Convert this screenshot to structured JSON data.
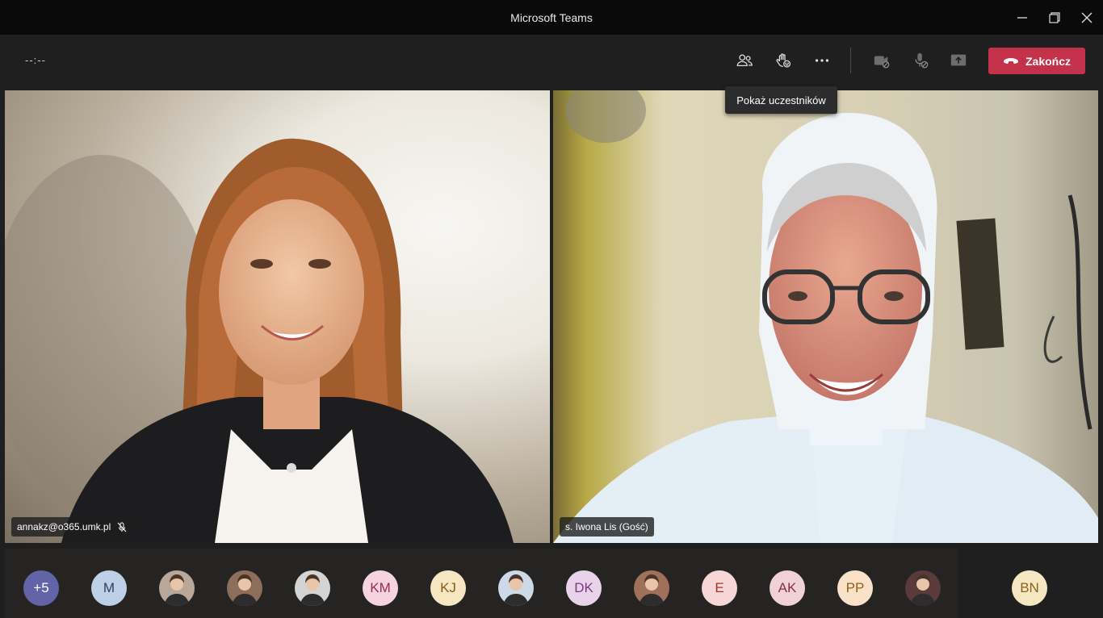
{
  "window": {
    "title": "Microsoft Teams"
  },
  "toolbar": {
    "timer": "--:--",
    "icons": [
      "people-icon",
      "raise-hand-icon",
      "more-options-icon",
      "camera-off-icon",
      "mic-off-icon",
      "share-screen-icon"
    ],
    "end_label": "Zakończ",
    "tooltip": "Pokaż uczestników"
  },
  "videos": [
    {
      "name": "annakz@o365.umk.pl",
      "muted": true
    },
    {
      "name": "s. Iwona Lis (Gość)",
      "muted": false
    }
  ],
  "participants": [
    {
      "initials": "+5",
      "bg": "#6264a7",
      "fg": "#ffffff",
      "photo": false
    },
    {
      "initials": "M",
      "bg": "#bdd0e8",
      "fg": "#2c3e66",
      "photo": false
    },
    {
      "initials": "",
      "bg": "#b9a89a",
      "fg": "#ffffff",
      "photo": true
    },
    {
      "initials": "",
      "bg": "#8d6e5a",
      "fg": "#ffffff",
      "photo": true
    },
    {
      "initials": "",
      "bg": "#d4d4d4",
      "fg": "#ffffff",
      "photo": true
    },
    {
      "initials": "KM",
      "bg": "#f6d4df",
      "fg": "#9b2a55",
      "photo": false
    },
    {
      "initials": "KJ",
      "bg": "#f7e6c2",
      "fg": "#8a5a14",
      "photo": false
    },
    {
      "initials": "",
      "bg": "#cdd9e6",
      "fg": "#ffffff",
      "photo": true
    },
    {
      "initials": "DK",
      "bg": "#e9d3ea",
      "fg": "#7a3b7d",
      "photo": false
    },
    {
      "initials": "",
      "bg": "#a0705a",
      "fg": "#ffffff",
      "photo": true
    },
    {
      "initials": "E",
      "bg": "#f6d6d6",
      "fg": "#a3332e",
      "photo": false
    },
    {
      "initials": "AK",
      "bg": "#efd1d6",
      "fg": "#8c2e44",
      "photo": false
    },
    {
      "initials": "PP",
      "bg": "#f9e2c8",
      "fg": "#985c17",
      "photo": false
    },
    {
      "initials": "",
      "bg": "#5a3a3a",
      "fg": "#ffffff",
      "photo": true
    },
    {
      "initials": "BN",
      "bg": "#f6e7c3",
      "fg": "#8a6416",
      "photo": false
    }
  ],
  "colors": {
    "end_button": "#c4314b",
    "background": "#1f1f1f",
    "accent": "#6264a7"
  }
}
